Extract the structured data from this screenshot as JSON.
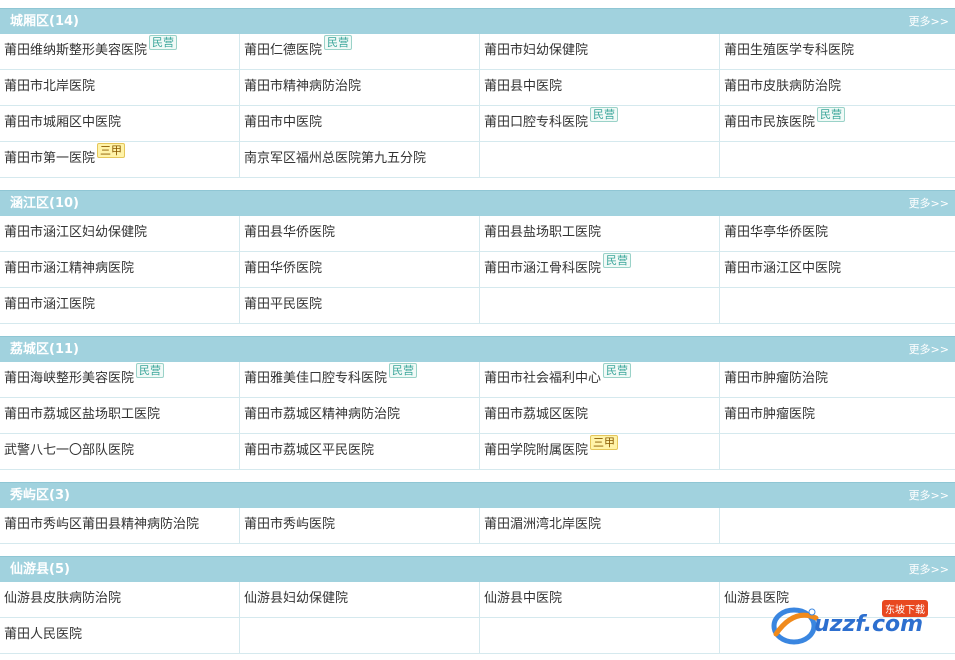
{
  "sections": [
    {
      "title": "城厢区(14)",
      "more": "更多>>",
      "rows": [
        [
          {
            "name": "莆田维纳斯整形美容医院",
            "badge": "民营",
            "badge_type": "min"
          },
          {
            "name": "莆田仁德医院",
            "badge": "民营",
            "badge_type": "min"
          },
          {
            "name": "莆田市妇幼保健院"
          },
          {
            "name": "莆田生殖医学专科医院"
          }
        ],
        [
          {
            "name": "莆田市北岸医院"
          },
          {
            "name": "莆田市精神病防治院"
          },
          {
            "name": "莆田县中医院"
          },
          {
            "name": "莆田市皮肤病防治院"
          }
        ],
        [
          {
            "name": "莆田市城厢区中医院"
          },
          {
            "name": "莆田市中医院"
          },
          {
            "name": "莆田口腔专科医院",
            "badge": "民营",
            "badge_type": "min"
          },
          {
            "name": "莆田市民族医院",
            "badge": "民营",
            "badge_type": "min"
          }
        ],
        [
          {
            "name": "莆田市第一医院",
            "badge": "三甲",
            "badge_type": "san"
          },
          {
            "name": "南京军区福州总医院第九五分院"
          },
          {
            "name": ""
          },
          {
            "name": ""
          }
        ]
      ]
    },
    {
      "title": "涵江区(10)",
      "more": "更多>>",
      "rows": [
        [
          {
            "name": "莆田市涵江区妇幼保健院"
          },
          {
            "name": "莆田县华侨医院"
          },
          {
            "name": "莆田县盐场职工医院"
          },
          {
            "name": "莆田华亭华侨医院"
          }
        ],
        [
          {
            "name": "莆田市涵江精神病医院"
          },
          {
            "name": "莆田华侨医院"
          },
          {
            "name": "莆田市涵江骨科医院",
            "badge": "民营",
            "badge_type": "min"
          },
          {
            "name": "莆田市涵江区中医院"
          }
        ],
        [
          {
            "name": "莆田市涵江医院"
          },
          {
            "name": "莆田平民医院"
          },
          {
            "name": ""
          },
          {
            "name": ""
          }
        ]
      ]
    },
    {
      "title": "荔城区(11)",
      "more": "更多>>",
      "rows": [
        [
          {
            "name": "莆田海峡整形美容医院",
            "badge": "民营",
            "badge_type": "min"
          },
          {
            "name": "莆田雅美佳口腔专科医院",
            "badge": "民营",
            "badge_type": "min"
          },
          {
            "name": "莆田市社会福利中心",
            "badge": "民营",
            "badge_type": "min"
          },
          {
            "name": "莆田市肿瘤防治院"
          }
        ],
        [
          {
            "name": "莆田市荔城区盐场职工医院"
          },
          {
            "name": "莆田市荔城区精神病防治院"
          },
          {
            "name": "莆田市荔城区医院"
          },
          {
            "name": "莆田市肿瘤医院"
          }
        ],
        [
          {
            "name": "武警八七一〇部队医院"
          },
          {
            "name": "莆田市荔城区平民医院"
          },
          {
            "name": "莆田学院附属医院",
            "badge": "三甲",
            "badge_type": "san"
          },
          {
            "name": ""
          }
        ]
      ]
    },
    {
      "title": "秀屿区(3)",
      "more": "更多>>",
      "rows": [
        [
          {
            "name": "莆田市秀屿区莆田县精神病防治院"
          },
          {
            "name": "莆田市秀屿医院"
          },
          {
            "name": "莆田湄洲湾北岸医院"
          },
          {
            "name": ""
          }
        ]
      ]
    },
    {
      "title": "仙游县(5)",
      "more": "更多>>",
      "rows": [
        [
          {
            "name": "仙游县皮肤病防治院"
          },
          {
            "name": "仙游县妇幼保健院"
          },
          {
            "name": "仙游县中医院"
          },
          {
            "name": "仙游县医院"
          }
        ],
        [
          {
            "name": "莆田人民医院"
          },
          {
            "name": ""
          },
          {
            "name": ""
          },
          {
            "name": ""
          }
        ]
      ]
    }
  ],
  "watermark": {
    "text": "uzzf.com",
    "tag": "东坡下载"
  }
}
